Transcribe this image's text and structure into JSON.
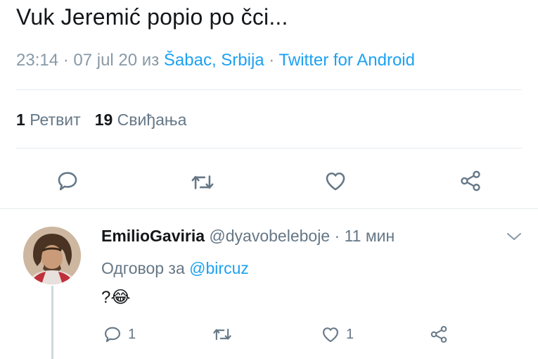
{
  "tweet": {
    "text": "Vuk Jeremić popio po čci...",
    "time": "23:14",
    "sep1": " · ",
    "date": "07 jul 20",
    "from": " из ",
    "location": "Šabac, Srbija",
    "sep2": " · ",
    "client": "Twitter for Android",
    "retweet_count": "1",
    "retweet_label": "Ретвит",
    "like_count": "19",
    "like_label": "Свиђања"
  },
  "actions": {
    "icons": [
      "reply-icon",
      "retweet-icon",
      "like-icon",
      "share-icon"
    ]
  },
  "reply": {
    "name": "EmilioGaviria",
    "handle": "@dyavobeleboje",
    "sep": " · ",
    "time": "11 мин",
    "reply_to_label": "Одговор за ",
    "reply_to_handle": "@bircuz",
    "body": "?😂",
    "reply_count": "1",
    "like_count": "1"
  },
  "colors": {
    "link": "#1da1f2",
    "icon": "#657786",
    "muted": "#8899a6"
  }
}
